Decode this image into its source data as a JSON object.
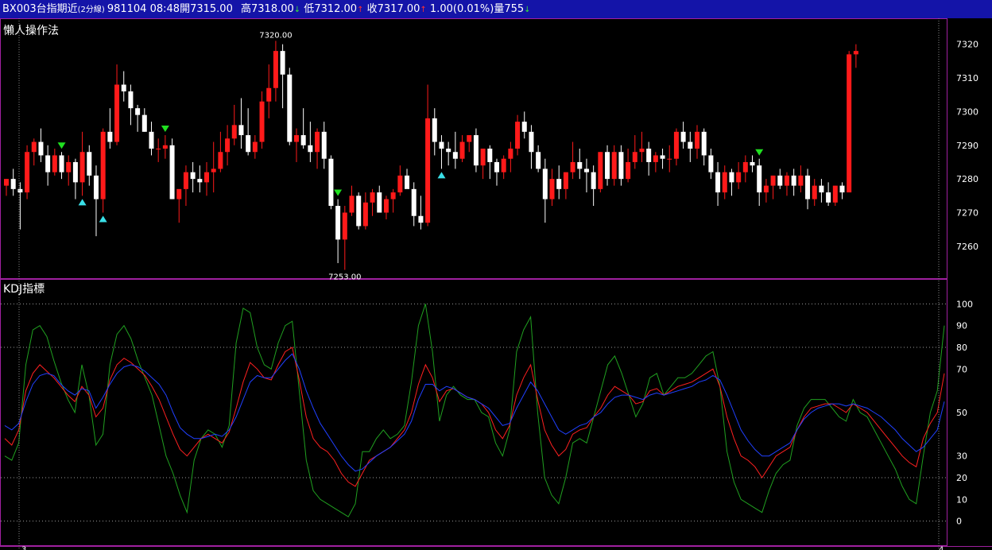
{
  "header": {
    "symbol": "BX003台指期近",
    "period": "(2分線)",
    "date": "981104",
    "time": "08:48",
    "open_label": "開",
    "open": "7315.00",
    "high_label": "高",
    "high": "7318.00",
    "low_label": "低",
    "low": "7312.00",
    "close_label": "收",
    "close": "7317.00",
    "change": "1.00",
    "change_pct": "(0.01%)",
    "volume_label": "量",
    "volume": "755",
    "arrow_up": "↑",
    "arrow_down": "↓"
  },
  "colors": {
    "title_bg": "#1414a8",
    "border": "#a020a0",
    "up_candle": "#ff1a1a",
    "down_candle": "#ffffff",
    "k_line": "#ff2020",
    "d_line": "#2040ff",
    "j_line": "#20a020",
    "buy_marker": "#3ae0e8",
    "sell_marker": "#20e020"
  },
  "chart_data": [
    {
      "type": "candlestick",
      "title": "懶人操作法",
      "y_ticks": [
        7260,
        7270,
        7280,
        7290,
        7300,
        7310,
        7320
      ],
      "ylim": [
        7251,
        7327
      ],
      "annotations": {
        "max_label": "7320.00",
        "min_label": "7253.00"
      },
      "ohlc": [
        [
          7278,
          7280,
          7275,
          7280
        ],
        [
          7280,
          7283,
          7275,
          7277
        ],
        [
          7277,
          7279,
          7265,
          7276
        ],
        [
          7276,
          7290,
          7274,
          7288
        ],
        [
          7288,
          7292,
          7284,
          7291
        ],
        [
          7291,
          7295,
          7285,
          7287
        ],
        [
          7287,
          7290,
          7278,
          7282
        ],
        [
          7282,
          7289,
          7281,
          7287
        ],
        [
          7287,
          7288,
          7280,
          7282
        ],
        [
          7282,
          7287,
          7278,
          7285
        ],
        [
          7285,
          7286,
          7274,
          7279
        ],
        [
          7279,
          7294,
          7275,
          7288
        ],
        [
          7288,
          7290,
          7278,
          7281
        ],
        [
          7281,
          7284,
          7263,
          7274
        ],
        [
          7274,
          7295,
          7270,
          7294
        ],
        [
          7294,
          7301,
          7289,
          7291
        ],
        [
          7291,
          7314,
          7290,
          7308
        ],
        [
          7308,
          7312,
          7303,
          7306
        ],
        [
          7306,
          7308,
          7296,
          7301
        ],
        [
          7301,
          7302,
          7294,
          7299
        ],
        [
          7299,
          7301,
          7294,
          7294
        ],
        [
          7294,
          7297,
          7287,
          7289
        ],
        [
          7289,
          7292,
          7285,
          7289
        ],
        [
          7289,
          7293,
          7286,
          7290
        ],
        [
          7290,
          7292,
          7274,
          7274
        ],
        [
          7274,
          7276,
          7267,
          7277
        ],
        [
          7277,
          7284,
          7272,
          7282
        ],
        [
          7282,
          7285,
          7276,
          7280
        ],
        [
          7280,
          7284,
          7276,
          7279
        ],
        [
          7279,
          7285,
          7275,
          7282
        ],
        [
          7282,
          7291,
          7276,
          7283
        ],
        [
          7283,
          7294,
          7282,
          7288
        ],
        [
          7288,
          7296,
          7284,
          7292
        ],
        [
          7292,
          7302,
          7290,
          7296
        ],
        [
          7296,
          7304,
          7289,
          7293
        ],
        [
          7293,
          7301,
          7287,
          7288
        ],
        [
          7288,
          7293,
          7286,
          7291
        ],
        [
          7291,
          7306,
          7289,
          7303
        ],
        [
          7303,
          7314,
          7298,
          7307
        ],
        [
          7307,
          7321,
          7303,
          7318
        ],
        [
          7318,
          7320,
          7301,
          7311
        ],
        [
          7311,
          7313,
          7290,
          7291
        ],
        [
          7291,
          7295,
          7285,
          7293
        ],
        [
          7293,
          7301,
          7289,
          7290
        ],
        [
          7290,
          7297,
          7285,
          7288
        ],
        [
          7288,
          7295,
          7283,
          7294
        ],
        [
          7294,
          7297,
          7283,
          7286
        ],
        [
          7286,
          7287,
          7271,
          7272
        ],
        [
          7272,
          7274,
          7255,
          7262
        ],
        [
          7262,
          7272,
          7253,
          7270
        ],
        [
          7270,
          7278,
          7269,
          7275
        ],
        [
          7275,
          7276,
          7265,
          7266
        ],
        [
          7266,
          7276,
          7265,
          7273
        ],
        [
          7273,
          7277,
          7269,
          7276
        ],
        [
          7276,
          7278,
          7270,
          7270
        ],
        [
          7270,
          7275,
          7268,
          7274
        ],
        [
          7274,
          7277,
          7270,
          7276
        ],
        [
          7276,
          7284,
          7275,
          7281
        ],
        [
          7281,
          7283,
          7278,
          7277
        ],
        [
          7277,
          7279,
          7266,
          7269
        ],
        [
          7269,
          7275,
          7265,
          7267
        ],
        [
          7267,
          7308,
          7266,
          7298
        ],
        [
          7298,
          7301,
          7287,
          7291
        ],
        [
          7291,
          7293,
          7283,
          7289
        ],
        [
          7289,
          7291,
          7284,
          7288
        ],
        [
          7288,
          7294,
          7283,
          7286
        ],
        [
          7286,
          7293,
          7285,
          7291
        ],
        [
          7291,
          7293,
          7288,
          7293
        ],
        [
          7293,
          7295,
          7282,
          7284
        ],
        [
          7284,
          7288,
          7280,
          7289
        ],
        [
          7289,
          7290,
          7280,
          7285
        ],
        [
          7285,
          7286,
          7278,
          7282
        ],
        [
          7282,
          7287,
          7280,
          7286
        ],
        [
          7286,
          7291,
          7282,
          7289
        ],
        [
          7289,
          7299,
          7287,
          7297
        ],
        [
          7297,
          7300,
          7292,
          7294
        ],
        [
          7294,
          7296,
          7283,
          7288
        ],
        [
          7288,
          7290,
          7282,
          7283
        ],
        [
          7283,
          7286,
          7267,
          7274
        ],
        [
          7274,
          7283,
          7272,
          7280
        ],
        [
          7280,
          7284,
          7274,
          7277
        ],
        [
          7277,
          7282,
          7274,
          7282
        ],
        [
          7282,
          7291,
          7280,
          7285
        ],
        [
          7285,
          7289,
          7280,
          7283
        ],
        [
          7283,
          7286,
          7276,
          7282
        ],
        [
          7282,
          7284,
          7272,
          7277
        ],
        [
          7277,
          7288,
          7276,
          7288
        ],
        [
          7288,
          7290,
          7278,
          7280
        ],
        [
          7280,
          7290,
          7278,
          7288
        ],
        [
          7288,
          7290,
          7278,
          7280
        ],
        [
          7280,
          7289,
          7279,
          7285
        ],
        [
          7285,
          7293,
          7283,
          7288
        ],
        [
          7288,
          7294,
          7285,
          7289
        ],
        [
          7289,
          7291,
          7281,
          7285
        ],
        [
          7285,
          7288,
          7282,
          7287
        ],
        [
          7287,
          7289,
          7283,
          7286
        ],
        [
          7286,
          7290,
          7282,
          7286
        ],
        [
          7286,
          7295,
          7284,
          7294
        ],
        [
          7294,
          7297,
          7289,
          7291
        ],
        [
          7291,
          7294,
          7285,
          7289
        ],
        [
          7289,
          7296,
          7286,
          7294
        ],
        [
          7294,
          7295,
          7284,
          7287
        ],
        [
          7287,
          7289,
          7280,
          7282
        ],
        [
          7282,
          7285,
          7272,
          7276
        ],
        [
          7276,
          7284,
          7274,
          7282
        ],
        [
          7282,
          7283,
          7275,
          7279
        ],
        [
          7279,
          7285,
          7277,
          7282
        ],
        [
          7282,
          7287,
          7279,
          7285
        ],
        [
          7285,
          7287,
          7282,
          7284
        ],
        [
          7284,
          7286,
          7272,
          7276
        ],
        [
          7276,
          7280,
          7273,
          7278
        ],
        [
          7278,
          7281,
          7274,
          7281
        ],
        [
          7281,
          7283,
          7277,
          7278
        ],
        [
          7278,
          7282,
          7275,
          7281
        ],
        [
          7281,
          7283,
          7275,
          7278
        ],
        [
          7278,
          7284,
          7276,
          7281
        ],
        [
          7281,
          7283,
          7271,
          7274
        ],
        [
          7274,
          7280,
          7272,
          7278
        ],
        [
          7278,
          7280,
          7273,
          7276
        ],
        [
          7276,
          7279,
          7272,
          7273
        ],
        [
          7273,
          7278,
          7272,
          7278
        ],
        [
          7278,
          7279,
          7274,
          7276
        ],
        [
          7276,
          7318,
          7316,
          7317
        ],
        [
          7317,
          7320,
          7313,
          7318
        ]
      ],
      "markers": [
        {
          "i": 8,
          "kind": "sell",
          "pos": "above"
        },
        {
          "i": 11,
          "kind": "buy",
          "pos": "below"
        },
        {
          "i": 14,
          "kind": "buy",
          "pos": "below"
        },
        {
          "i": 23,
          "kind": "sell",
          "pos": "above"
        },
        {
          "i": 48,
          "kind": "sell",
          "pos": "above"
        },
        {
          "i": 63,
          "kind": "buy",
          "pos": "below"
        },
        {
          "i": 109,
          "kind": "sell",
          "pos": "above"
        }
      ]
    },
    {
      "type": "line",
      "title": "KDJ指標",
      "y_ticks": [
        0,
        10,
        20,
        30,
        50,
        70,
        80,
        90,
        100
      ],
      "ylim": [
        -10,
        110
      ],
      "dotted_levels": [
        0,
        20,
        80,
        100
      ],
      "series": [
        {
          "key": "K",
          "values": [
            38,
            35,
            42,
            60,
            68,
            72,
            69,
            66,
            62,
            58,
            55,
            62,
            58,
            48,
            52,
            65,
            72,
            75,
            73,
            70,
            67,
            62,
            56,
            48,
            40,
            33,
            30,
            34,
            38,
            40,
            38,
            36,
            41,
            52,
            64,
            73,
            70,
            66,
            65,
            72,
            78,
            80,
            65,
            48,
            38,
            34,
            32,
            28,
            22,
            18,
            16,
            22,
            28,
            30,
            32,
            34,
            38,
            42,
            50,
            63,
            72,
            66,
            55,
            60,
            61,
            59,
            57,
            56,
            54,
            50,
            42,
            38,
            44,
            58,
            66,
            72,
            56,
            42,
            35,
            30,
            33,
            40,
            42,
            43,
            48,
            52,
            58,
            62,
            60,
            58,
            54,
            55,
            60,
            61,
            58,
            60,
            62,
            63,
            64,
            66,
            68,
            70,
            62,
            48,
            38,
            30,
            28,
            25,
            20,
            25,
            30,
            32,
            34,
            42,
            48,
            52,
            53,
            54,
            54,
            52,
            50,
            54,
            52,
            50,
            46,
            42,
            38,
            34,
            30,
            27,
            25,
            38,
            45,
            50,
            68
          ]
        },
        {
          "key": "D",
          "values": [
            44,
            42,
            45,
            55,
            63,
            67,
            68,
            67,
            63,
            60,
            58,
            61,
            60,
            52,
            57,
            63,
            68,
            71,
            72,
            71,
            69,
            66,
            63,
            58,
            50,
            43,
            40,
            38,
            38,
            39,
            40,
            39,
            42,
            48,
            56,
            64,
            67,
            66,
            66,
            70,
            74,
            77,
            70,
            60,
            52,
            45,
            40,
            35,
            30,
            26,
            23,
            24,
            27,
            30,
            32,
            34,
            37,
            40,
            46,
            56,
            63,
            63,
            60,
            62,
            61,
            59,
            57,
            56,
            54,
            52,
            48,
            44,
            45,
            52,
            58,
            64,
            60,
            54,
            48,
            42,
            40,
            42,
            44,
            45,
            48,
            50,
            54,
            57,
            58,
            58,
            57,
            56,
            58,
            59,
            58,
            59,
            60,
            61,
            62,
            64,
            65,
            67,
            65,
            58,
            50,
            42,
            37,
            33,
            30,
            30,
            32,
            34,
            36,
            42,
            47,
            50,
            52,
            53,
            54,
            54,
            53,
            54,
            53,
            52,
            50,
            48,
            45,
            42,
            38,
            35,
            32,
            34,
            38,
            42,
            55
          ]
        },
        {
          "key": "J",
          "values": [
            30,
            28,
            36,
            72,
            88,
            90,
            85,
            74,
            64,
            56,
            50,
            72,
            58,
            35,
            40,
            72,
            86,
            90,
            84,
            74,
            66,
            58,
            44,
            30,
            22,
            12,
            4,
            28,
            38,
            42,
            40,
            34,
            44,
            82,
            98,
            96,
            80,
            72,
            70,
            82,
            90,
            92,
            60,
            28,
            14,
            10,
            8,
            6,
            4,
            2,
            8,
            32,
            32,
            38,
            42,
            38,
            40,
            44,
            64,
            90,
            100,
            78,
            46,
            58,
            62,
            58,
            56,
            56,
            50,
            48,
            36,
            30,
            42,
            78,
            88,
            94,
            50,
            20,
            12,
            8,
            20,
            36,
            38,
            36,
            48,
            60,
            72,
            76,
            68,
            58,
            48,
            54,
            66,
            68,
            58,
            62,
            66,
            66,
            68,
            72,
            76,
            78,
            62,
            32,
            18,
            10,
            8,
            6,
            4,
            14,
            22,
            26,
            28,
            44,
            52,
            56,
            56,
            56,
            52,
            48,
            46,
            56,
            50,
            48,
            42,
            36,
            30,
            24,
            16,
            10,
            8,
            30,
            50,
            60,
            90
          ]
        }
      ]
    }
  ],
  "x_axis": {
    "left_label": "3",
    "right_label": "4"
  }
}
